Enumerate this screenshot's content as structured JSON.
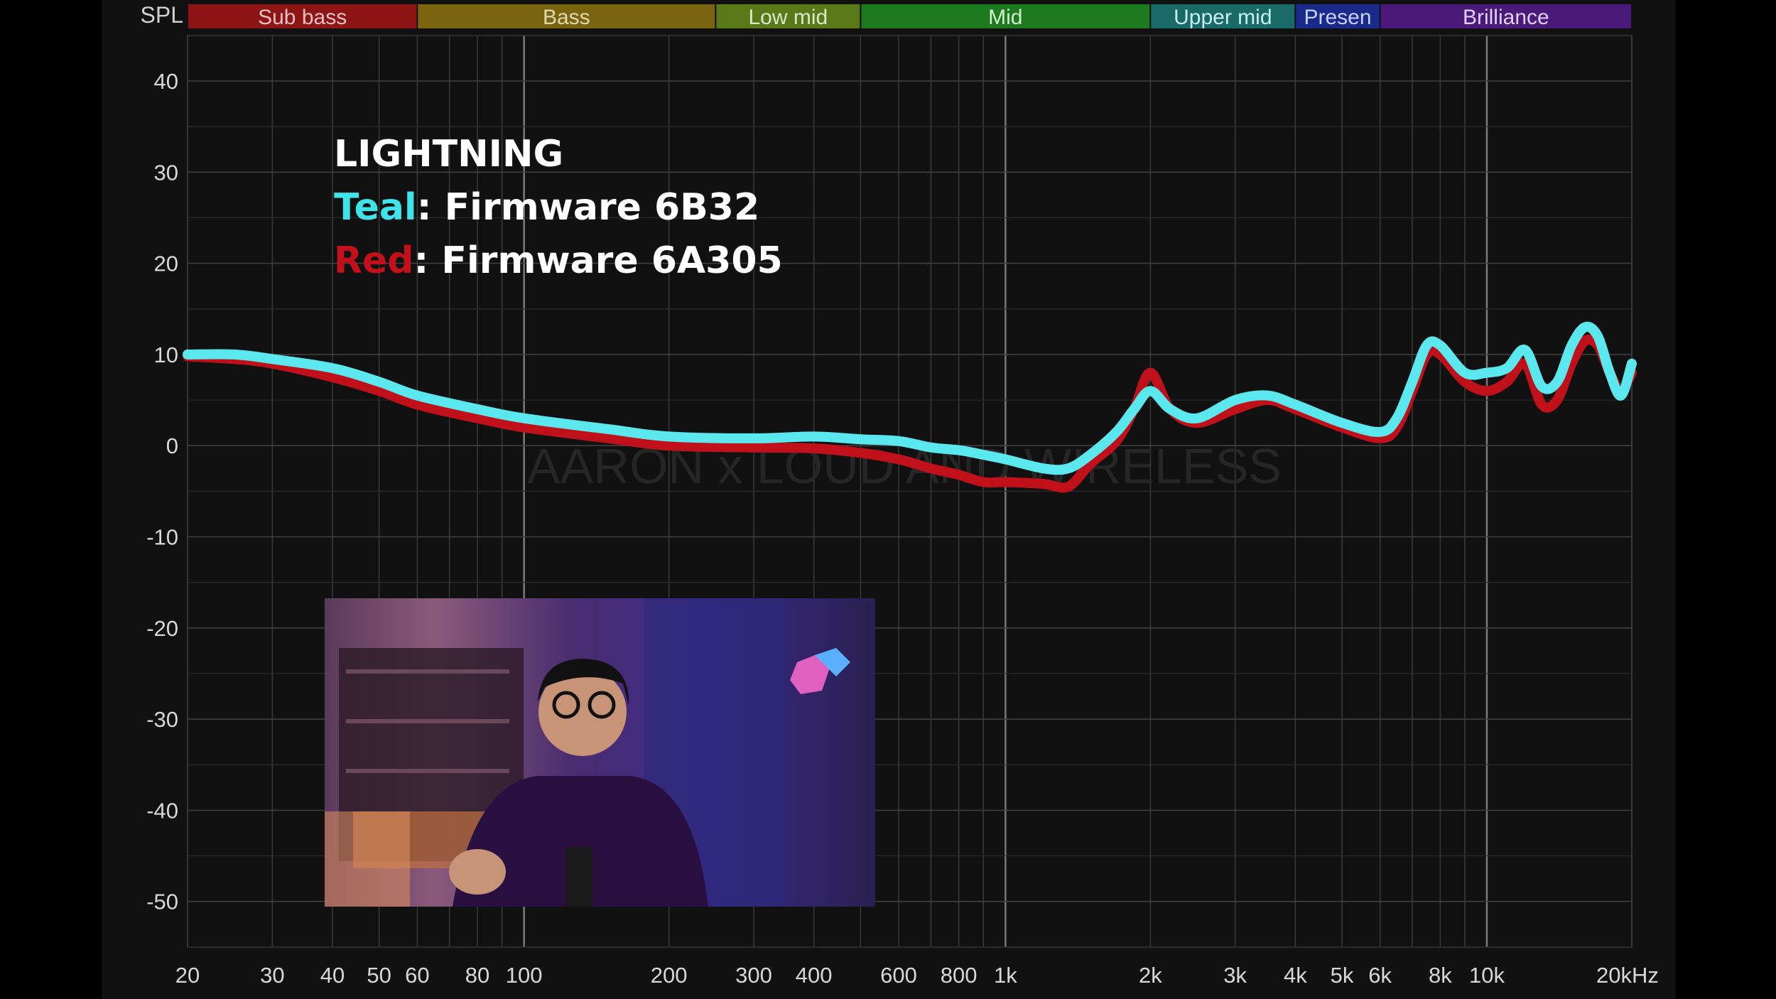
{
  "colors": {
    "background": "#111111",
    "grid": "#3a3a3a",
    "grid_major": "#7a7a7a",
    "teal": "#5ae8ee",
    "red": "#c0101a"
  },
  "annotation": {
    "title": "LIGHTNING",
    "teal_word": "Teal",
    "teal_rest": ": Firmware 6B32",
    "red_word": "Red",
    "red_rest": ": Firmware 6A305"
  },
  "watermark": "AARON x LOUD AND WIRELESS",
  "video_overlay": {
    "description_icon": "person-webcam-inset"
  },
  "chart_data": {
    "type": "line",
    "title": "",
    "ylabel": "SPL",
    "xlabel": "",
    "xscale": "log",
    "xlim": [
      20,
      20000
    ],
    "ylim": [
      -55,
      45
    ],
    "y_ticks": [
      40,
      30,
      20,
      10,
      0,
      -10,
      -20,
      -30,
      -40,
      -50
    ],
    "x_ticks": [
      {
        "v": 20,
        "label": "20"
      },
      {
        "v": 30,
        "label": "30"
      },
      {
        "v": 40,
        "label": "40"
      },
      {
        "v": 50,
        "label": "50"
      },
      {
        "v": 60,
        "label": "60"
      },
      {
        "v": 80,
        "label": "80"
      },
      {
        "v": 100,
        "label": "100"
      },
      {
        "v": 200,
        "label": "200"
      },
      {
        "v": 300,
        "label": "300"
      },
      {
        "v": 400,
        "label": "400"
      },
      {
        "v": 600,
        "label": "600"
      },
      {
        "v": 800,
        "label": "800"
      },
      {
        "v": 1000,
        "label": "1k"
      },
      {
        "v": 2000,
        "label": "2k"
      },
      {
        "v": 3000,
        "label": "3k"
      },
      {
        "v": 4000,
        "label": "4k"
      },
      {
        "v": 5000,
        "label": "5k"
      },
      {
        "v": 6000,
        "label": "6k"
      },
      {
        "v": 8000,
        "label": "8k"
      },
      {
        "v": 10000,
        "label": "10k"
      },
      {
        "v": 20000,
        "label": "20kHz"
      }
    ],
    "bands": [
      {
        "name": "Sub bass",
        "from": 20,
        "to": 60,
        "color": "#8e1515",
        "text": "#e8c0c0"
      },
      {
        "name": "Bass",
        "from": 60,
        "to": 250,
        "color": "#7a6410",
        "text": "#e0d8b0"
      },
      {
        "name": "Low mid",
        "from": 250,
        "to": 500,
        "color": "#5a7a1a",
        "text": "#d8e8c8"
      },
      {
        "name": "Mid",
        "from": 500,
        "to": 2000,
        "color": "#1e7a1e",
        "text": "#d0f0d0"
      },
      {
        "name": "Upper mid",
        "from": 2000,
        "to": 4000,
        "color": "#1a6a6a",
        "text": "#c8f0f0"
      },
      {
        "name": "Presen",
        "from": 4000,
        "to": 6000,
        "color": "#1a2a8a",
        "text": "#c8d0ff"
      },
      {
        "name": "Brilliance",
        "from": 6000,
        "to": 20000,
        "color": "#4a1a7a",
        "text": "#e0d0f8"
      }
    ],
    "series": [
      {
        "name": "Firmware 6A305",
        "color": "#c0101a",
        "points": [
          [
            20,
            9.8
          ],
          [
            25,
            9.5
          ],
          [
            30,
            9
          ],
          [
            40,
            7.5
          ],
          [
            50,
            6
          ],
          [
            60,
            4.5
          ],
          [
            80,
            3
          ],
          [
            100,
            2
          ],
          [
            150,
            0.8
          ],
          [
            200,
            0
          ],
          [
            300,
            -0.2
          ],
          [
            400,
            -0.3
          ],
          [
            500,
            -0.8
          ],
          [
            600,
            -1.5
          ],
          [
            700,
            -2.5
          ],
          [
            800,
            -3.2
          ],
          [
            900,
            -4
          ],
          [
            1000,
            -4
          ],
          [
            1200,
            -4.2
          ],
          [
            1350,
            -4.5
          ],
          [
            1500,
            -2
          ],
          [
            1700,
            0.5
          ],
          [
            1850,
            4
          ],
          [
            2000,
            8
          ],
          [
            2200,
            4
          ],
          [
            2500,
            2.5
          ],
          [
            3000,
            4
          ],
          [
            3500,
            5
          ],
          [
            4000,
            4
          ],
          [
            5000,
            2
          ],
          [
            6000,
            0.8
          ],
          [
            6500,
            2
          ],
          [
            7000,
            6
          ],
          [
            7500,
            10
          ],
          [
            8000,
            10
          ],
          [
            9000,
            7
          ],
          [
            10000,
            6
          ],
          [
            11000,
            7
          ],
          [
            12000,
            9
          ],
          [
            13000,
            4.5
          ],
          [
            14000,
            5
          ],
          [
            15000,
            9
          ],
          [
            16000,
            11.5
          ],
          [
            17000,
            11
          ],
          [
            18000,
            8
          ],
          [
            19000,
            6
          ],
          [
            20000,
            8
          ]
        ]
      },
      {
        "name": "Firmware 6B32",
        "color": "#5ae8ee",
        "points": [
          [
            20,
            10
          ],
          [
            25,
            10
          ],
          [
            30,
            9.5
          ],
          [
            40,
            8.5
          ],
          [
            50,
            7
          ],
          [
            60,
            5.5
          ],
          [
            80,
            4
          ],
          [
            100,
            3
          ],
          [
            150,
            1.8
          ],
          [
            200,
            1
          ],
          [
            300,
            0.8
          ],
          [
            400,
            1
          ],
          [
            500,
            0.7
          ],
          [
            600,
            0.5
          ],
          [
            700,
            -0.2
          ],
          [
            800,
            -0.5
          ],
          [
            900,
            -1
          ],
          [
            1000,
            -1.5
          ],
          [
            1200,
            -2.5
          ],
          [
            1350,
            -2.5
          ],
          [
            1500,
            -1
          ],
          [
            1700,
            1.5
          ],
          [
            1850,
            4
          ],
          [
            2000,
            6
          ],
          [
            2200,
            4
          ],
          [
            2500,
            3
          ],
          [
            3000,
            5
          ],
          [
            3500,
            5.5
          ],
          [
            4000,
            4.5
          ],
          [
            5000,
            2.5
          ],
          [
            6000,
            1.5
          ],
          [
            6500,
            3
          ],
          [
            7000,
            7
          ],
          [
            7500,
            11
          ],
          [
            8000,
            11
          ],
          [
            9000,
            8
          ],
          [
            10000,
            8
          ],
          [
            11000,
            8.5
          ],
          [
            12000,
            10.5
          ],
          [
            13000,
            6.5
          ],
          [
            14000,
            7
          ],
          [
            15000,
            11
          ],
          [
            16000,
            13
          ],
          [
            17000,
            12
          ],
          [
            18000,
            8
          ],
          [
            19000,
            5.5
          ],
          [
            20000,
            9
          ]
        ]
      }
    ]
  }
}
